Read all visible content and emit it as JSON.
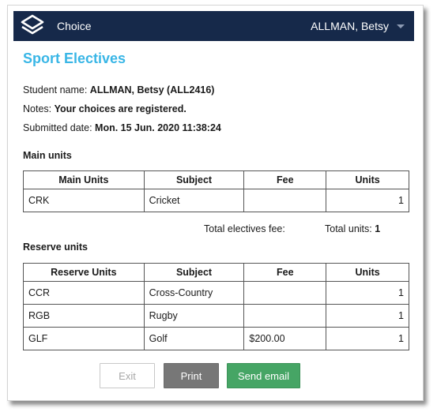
{
  "header": {
    "app_title": "Choice",
    "user_name": "ALLMAN, Betsy",
    "logo_icon": "stacked-layers-icon",
    "menu_icon": "caret-down-icon",
    "bar_color": "#16294a"
  },
  "page": {
    "title": "Sport Electives",
    "title_color": "#39b6e6"
  },
  "student": {
    "name_label": "Student name:",
    "name_value": "ALLMAN, Betsy (ALL2416)",
    "notes_label": "Notes:",
    "notes_value": "Your choices are registered.",
    "submitted_label": "Submitted date:",
    "submitted_value": "Mon. 15 Jun. 2020 11:38:24"
  },
  "main_units": {
    "section_title": "Main units",
    "columns": [
      "Main Units",
      "Subject",
      "Fee",
      "Units"
    ],
    "rows": [
      {
        "code": "CRK",
        "subject": "Cricket",
        "fee": "",
        "units": "1"
      }
    ]
  },
  "totals": {
    "fee_label": "Total electives fee:",
    "units_label": "Total units:",
    "units_value": "1"
  },
  "reserve_units": {
    "section_title": "Reserve units",
    "columns": [
      "Reserve Units",
      "Subject",
      "Fee",
      "Units"
    ],
    "rows": [
      {
        "code": "CCR",
        "subject": "Cross-Country",
        "fee": "",
        "units": "1"
      },
      {
        "code": "RGB",
        "subject": "Rugby",
        "fee": "",
        "units": "1"
      },
      {
        "code": "GLF",
        "subject": "Golf",
        "fee": "$200.00",
        "units": "1"
      }
    ]
  },
  "actions": {
    "exit_label": "Exit",
    "print_label": "Print",
    "email_label": "Send email",
    "email_color": "#46a565",
    "print_color": "#777777"
  }
}
